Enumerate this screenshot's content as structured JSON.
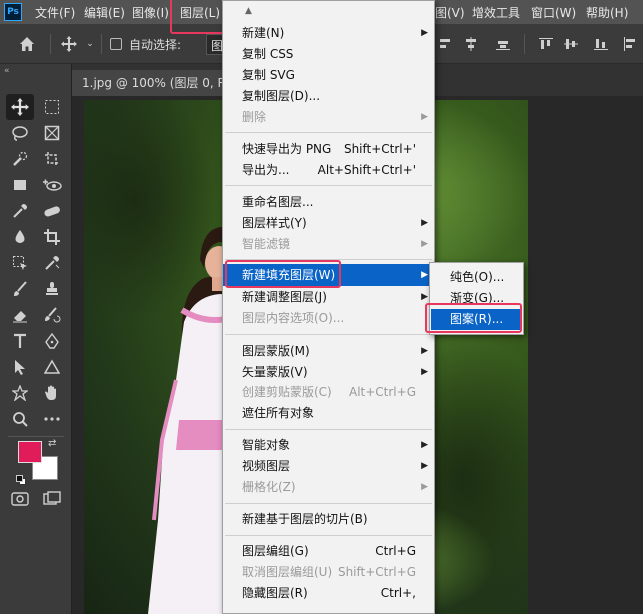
{
  "app": {
    "logo_text": "Ps"
  },
  "menubar": {
    "items": [
      "文件(F)",
      "编辑(E)",
      "图像(I)",
      "图层(L)",
      "图(V)",
      "增效工具",
      "窗口(W)",
      "帮助(H)"
    ]
  },
  "options_bar": {
    "auto_select_label": "自动选择:",
    "auto_select_value": "图"
  },
  "document": {
    "tab_title": "1.jpg @ 100% (图层 0, R"
  },
  "layer_menu": {
    "items": [
      {
        "label": "新建(N)",
        "shortcut": "",
        "submenu": true,
        "disabled": false
      },
      {
        "label": "复制 CSS",
        "shortcut": "",
        "submenu": false,
        "disabled": false
      },
      {
        "label": "复制 SVG",
        "shortcut": "",
        "submenu": false,
        "disabled": false
      },
      {
        "label": "复制图层(D)...",
        "shortcut": "",
        "submenu": false,
        "disabled": false
      },
      {
        "label": "删除",
        "shortcut": "",
        "submenu": true,
        "disabled": true
      },
      {
        "label": "快速导出为 PNG",
        "shortcut": "Shift+Ctrl+'",
        "submenu": false,
        "disabled": false
      },
      {
        "label": "导出为...",
        "shortcut": "Alt+Shift+Ctrl+'",
        "submenu": false,
        "disabled": false
      },
      {
        "label": "重命名图层...",
        "shortcut": "",
        "submenu": false,
        "disabled": false
      },
      {
        "label": "图层样式(Y)",
        "shortcut": "",
        "submenu": true,
        "disabled": false
      },
      {
        "label": "智能滤镜",
        "shortcut": "",
        "submenu": true,
        "disabled": true
      },
      {
        "label": "新建填充图层(W)",
        "shortcut": "",
        "submenu": true,
        "disabled": false,
        "selected": true
      },
      {
        "label": "新建调整图层(J)",
        "shortcut": "",
        "submenu": true,
        "disabled": false
      },
      {
        "label": "图层内容选项(O)...",
        "shortcut": "",
        "submenu": false,
        "disabled": true
      },
      {
        "label": "图层蒙版(M)",
        "shortcut": "",
        "submenu": true,
        "disabled": false
      },
      {
        "label": "矢量蒙版(V)",
        "shortcut": "",
        "submenu": true,
        "disabled": false
      },
      {
        "label": "创建剪贴蒙版(C)",
        "shortcut": "Alt+Ctrl+G",
        "submenu": false,
        "disabled": true
      },
      {
        "label": "遮住所有对象",
        "shortcut": "",
        "submenu": false,
        "disabled": false
      },
      {
        "label": "智能对象",
        "shortcut": "",
        "submenu": true,
        "disabled": false
      },
      {
        "label": "视频图层",
        "shortcut": "",
        "submenu": true,
        "disabled": false
      },
      {
        "label": "栅格化(Z)",
        "shortcut": "",
        "submenu": true,
        "disabled": true
      },
      {
        "label": "新建基于图层的切片(B)",
        "shortcut": "",
        "submenu": false,
        "disabled": false
      },
      {
        "label": "图层编组(G)",
        "shortcut": "Ctrl+G",
        "submenu": false,
        "disabled": false
      },
      {
        "label": "取消图层编组(U)",
        "shortcut": "Shift+Ctrl+G",
        "submenu": false,
        "disabled": true
      },
      {
        "label": "隐藏图层(R)",
        "shortcut": "Ctrl+,",
        "submenu": false,
        "disabled": false
      }
    ]
  },
  "fill_submenu": {
    "items": [
      {
        "label": "纯色(O)...",
        "selected": false
      },
      {
        "label": "渐变(G)...",
        "selected": false
      },
      {
        "label": "图案(R)...",
        "selected": true
      }
    ]
  },
  "colors": {
    "foreground": "#e01d5a",
    "background": "#ffffff",
    "highlight_box": "#e8375f",
    "menu_selection": "#0a64c8"
  }
}
